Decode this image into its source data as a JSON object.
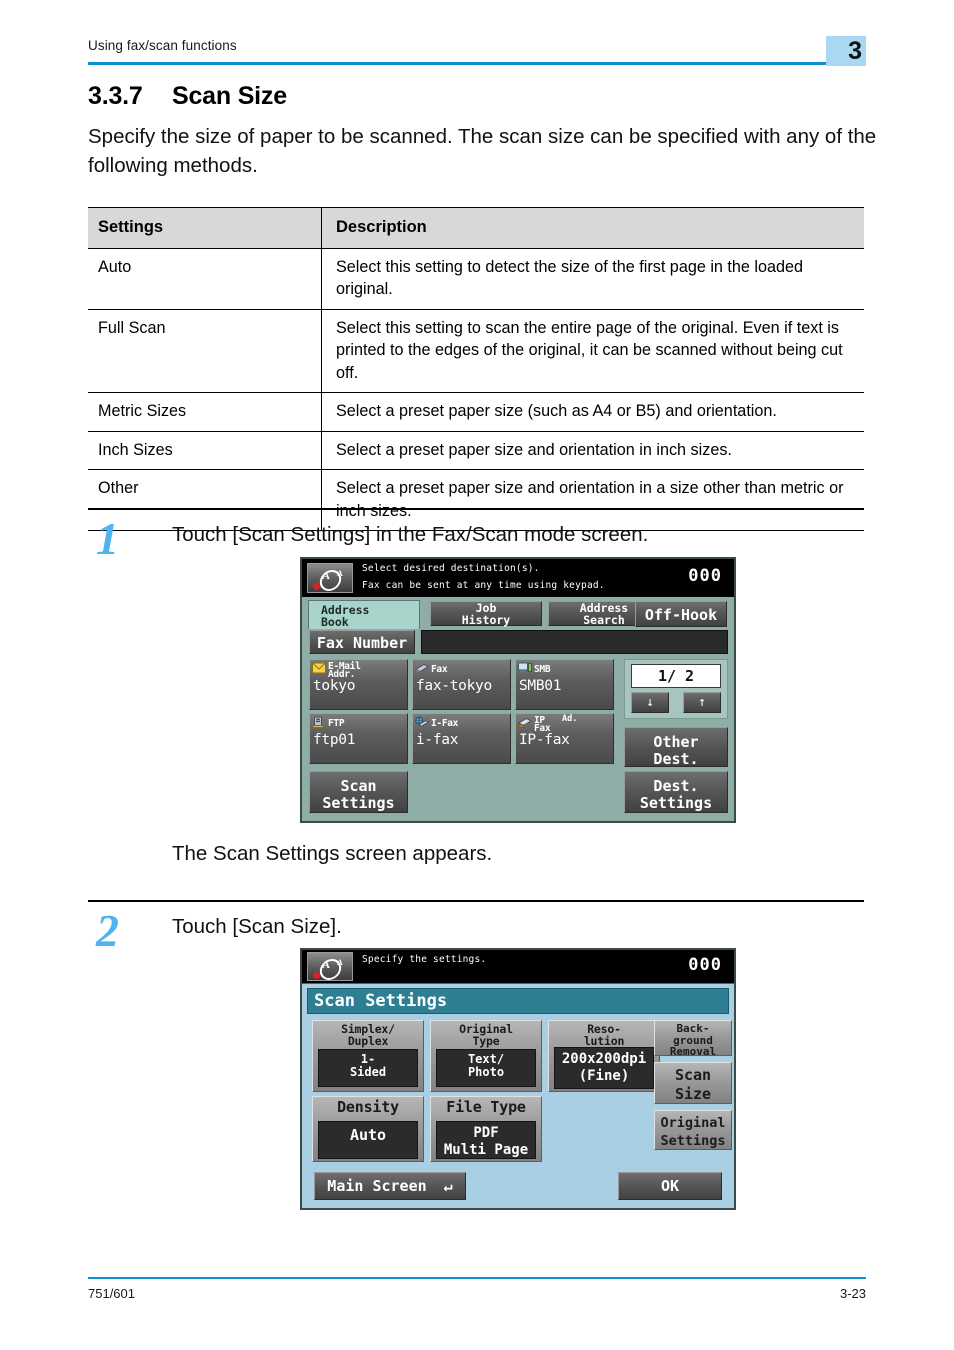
{
  "header": {
    "running_head": "Using fax/scan functions",
    "chapter_number": "3",
    "accent_color": "#0d8fd4",
    "badge_color": "#a9d8f2"
  },
  "section": {
    "number": "3.3.7",
    "title": "Scan Size",
    "intro": "Specify the size of paper to be scanned. The scan size can be specified with any of the following methods."
  },
  "table": {
    "headers": [
      "Settings",
      "Description"
    ],
    "rows": [
      {
        "setting": "Auto",
        "description": "Select this setting to detect the size of the first page in the loaded original."
      },
      {
        "setting": "Full Scan",
        "description": "Select this setting to scan the entire page of the original.  Even if text is printed to the edges of the original, it can be scanned without being cut off."
      },
      {
        "setting": "Metric Sizes",
        "description": "Select a preset paper size (such as A4 or B5) and orientation."
      },
      {
        "setting": "Inch Sizes",
        "description": "Select a preset paper size and orientation in inch sizes."
      },
      {
        "setting": "Other",
        "description": "Select a preset paper size and orientation in a size other than metric or inch sizes."
      }
    ]
  },
  "steps": [
    {
      "number": "1",
      "text": "Touch [Scan Settings] in the Fax/Scan mode screen.",
      "result": "The Scan Settings screen appears."
    },
    {
      "number": "2",
      "text": "Touch [Scan Size]."
    }
  ],
  "lcd1": {
    "message_line1": "Select desired destination(s).",
    "message_line2": "Fax can be sent at any time using keypad.",
    "counter": "000",
    "tab_active": {
      "line1": "Address",
      "line2": "Book"
    },
    "tabs": [
      {
        "line1": "Job",
        "line2": "History"
      },
      {
        "line1": "Address",
        "line2": "Search"
      }
    ],
    "off_hook": "Off-Hook",
    "fax_number": "Fax Number",
    "destinations": [
      {
        "type_line1": "E-Mail",
        "type_line2": "Addr.",
        "name": "tokyo",
        "icon": "envelope-icon"
      },
      {
        "type_line1": "Fax",
        "type_line2": "",
        "name": "fax-tokyo",
        "icon": "fax-machine-icon"
      },
      {
        "type_line1": "SMB",
        "type_line2": "",
        "name": "SMB01",
        "icon": "monitor-icon"
      },
      {
        "type_line1": "FTP",
        "type_line2": "",
        "name": "ftp01",
        "icon": "server-icon"
      },
      {
        "type_line1": "I-Fax",
        "type_line2": "",
        "name": "i-fax",
        "icon": "globe-fax-icon"
      },
      {
        "type_line1": "IP",
        "type_line2": "Fax",
        "type_sup": "Ad.",
        "name": "IP-fax",
        "icon": "ip-fax-icon"
      }
    ],
    "page_indicator": "1/  2",
    "arrow_down": "↓",
    "arrow_up": "↑",
    "other_dest": {
      "line1": "Other",
      "line2": "Dest."
    },
    "scan_settings": {
      "line1": "Scan",
      "line2": "Settings"
    },
    "dest_settings": {
      "line1": "Dest.",
      "line2": "Settings"
    }
  },
  "lcd2": {
    "message_line1": "Specify the settings.",
    "counter": "000",
    "title": "Scan Settings",
    "buttons": [
      {
        "label_line1": "Simplex/",
        "label_line2": "Duplex",
        "value_line1": "1-",
        "value_line2": "Sided"
      },
      {
        "label_line1": "Original",
        "label_line2": "Type",
        "value_line1": "Text/",
        "value_line2": "Photo"
      },
      {
        "label_line1": "Reso-",
        "label_line2": "lution",
        "value_line1": "200x200dpi",
        "value_line2": "(Fine)"
      },
      {
        "label_line1": "Density",
        "label_line2": "",
        "value_line1": "Auto",
        "value_line2": ""
      },
      {
        "label_line1": "File Type",
        "label_line2": "",
        "value_line1": "PDF",
        "value_line2": "Multi Page"
      }
    ],
    "side_buttons": [
      {
        "line1": "Back-",
        "line2": "ground",
        "line3": "Removal"
      },
      {
        "line1": "Scan",
        "line2": "Size",
        "line3": ""
      },
      {
        "line1": "Original",
        "line2": "Settings",
        "line3": ""
      }
    ],
    "main_screen": "Main Screen",
    "main_screen_icon": "↵",
    "ok": "OK"
  },
  "footer": {
    "left": "751/601",
    "right": "3-23"
  }
}
